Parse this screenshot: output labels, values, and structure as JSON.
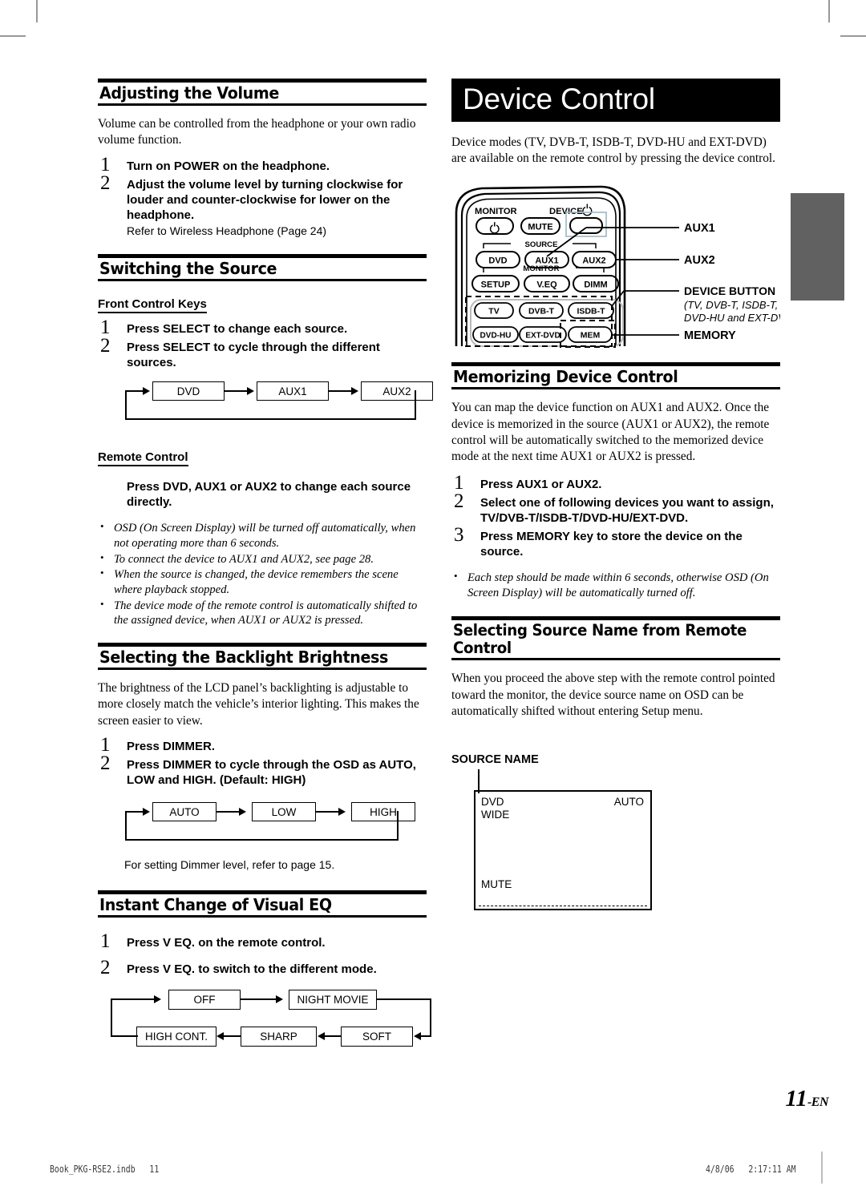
{
  "page": {
    "number": "11",
    "lang_suffix": "-EN",
    "footer_left": "Book_PKG-RSE2.indb   11",
    "footer_right": "4/8/06   2:17:11 AM"
  },
  "left_column": {
    "volume": {
      "heading": "Adjusting the Volume",
      "intro": "Volume can be controlled from the headphone or your own radio volume function.",
      "steps": [
        {
          "num": "1",
          "pre": "Turn on ",
          "kbd": "POWER",
          "post": " on the headphone.",
          "sub": ""
        },
        {
          "num": "2",
          "pre": "Adjust the volume level by turning clockwise for louder and counter-clockwise for lower on the headphone.",
          "kbd": "",
          "post": "",
          "sub": "Refer to Wireless Headphone (Page 24)"
        }
      ]
    },
    "switching": {
      "heading": "Switching the Source",
      "subhead_front": "Front Control Keys",
      "steps": [
        {
          "num": "1",
          "pre": "Press ",
          "kbd": "SELECT",
          "post": " to change each source."
        },
        {
          "num": "2",
          "pre": "Press ",
          "kbd": "SELECT",
          "post": " to cycle through the different sources."
        }
      ],
      "source_flow": [
        "DVD",
        "AUX1",
        "AUX2"
      ],
      "subhead_remote": "Remote Control",
      "remote_instruction_pre": "Press ",
      "remote_instruction_kbd1": "DVD, AUX1",
      "remote_instruction_mid": " or ",
      "remote_instruction_kbd2": "AUX2",
      "remote_instruction_post": " to change each source directly.",
      "notes": [
        "OSD (On Screen Display) will be turned off automatically, when not operating more than 6 seconds.",
        "To connect the device to AUX1 and AUX2, see page 28.",
        "When the source is changed, the device remembers the scene where playback stopped.",
        "The device mode of the remote control is automatically shifted to the assigned device, when AUX1 or AUX2 is pressed."
      ]
    },
    "backlight": {
      "heading": "Selecting the Backlight Brightness",
      "intro": "The brightness of the LCD panel’s backlighting is adjustable to more closely match the vehicle’s interior lighting. This makes the screen easier to view.",
      "steps": [
        {
          "num": "1",
          "pre": "Press ",
          "kbd": "DIMMER",
          "post": "."
        },
        {
          "num": "2",
          "pre": "Press ",
          "kbd": "DIMMER",
          "post": " to cycle through the OSD as AUTO, LOW and HIGH. (Default: HIGH)"
        }
      ],
      "dimmer_flow": [
        "AUTO",
        "LOW",
        "HIGH"
      ],
      "footnote": "For setting Dimmer level, refer to page 15."
    },
    "visualeq": {
      "heading": "Instant Change of Visual EQ",
      "steps": [
        {
          "num": "1",
          "pre": "Press ",
          "kbd": "V EQ.",
          "post": " on the remote control."
        },
        {
          "num": "2",
          "pre": "Press ",
          "kbd": "V EQ.",
          "post": " to switch to the different mode."
        }
      ],
      "eq_flow_top": [
        "OFF",
        "NIGHT MOVIE"
      ],
      "eq_flow_bottom": [
        "HIGH CONT.",
        "SHARP",
        "SOFT"
      ]
    }
  },
  "right_column": {
    "title_bar": "Device Control",
    "intro": "Device modes (TV, DVB-T, ISDB-T, DVD-HU and EXT-DVD) are available on the remote control by pressing the device control.",
    "remote": {
      "label_monitor_power": "MONITOR",
      "label_device_power": "DEVICE",
      "buttons": {
        "mute": "MUTE",
        "dvd": "DVD",
        "aux1": "AUX1",
        "aux2": "AUX2",
        "setup": "SETUP",
        "veq": "V.EQ",
        "dimm": "DIMM",
        "tv": "TV",
        "dvbt": "DVB-T",
        "isdbt": "ISDB-T",
        "dvdhu": "DVD-HU",
        "extdvd": "EXT-DVD",
        "mem": "MEM"
      },
      "group_source": "SOURCE",
      "group_monitor": "MONITOR",
      "callouts": {
        "aux1": "AUX1",
        "aux2": "AUX2",
        "device_button": "DEVICE BUTTON",
        "device_button_sub": "(TV, DVB-T, ISDB-T, DVD-HU and EXT-DVD)",
        "memory": "MEMORY"
      }
    },
    "memorizing": {
      "heading": "Memorizing Device Control",
      "intro": "You can map the device function on AUX1 and AUX2. Once the device is memorized in the source (AUX1 or AUX2), the remote control will be automatically switched to the memorized device mode at the next time AUX1 or AUX2 is pressed.",
      "steps": [
        {
          "num": "1",
          "pre": "Press ",
          "kbd": "AUX1",
          "mid": " or ",
          "kbd2": "AUX2",
          "post": "."
        },
        {
          "num": "2",
          "pre": "Select one of following devices you want to assign, ",
          "kbd": "TV/DVB-T/ISDB-T/DVD-HU/EXT-DVD",
          "post": "."
        },
        {
          "num": "3",
          "pre": "Press  ",
          "kbd": "MEMORY",
          "post": " key to store the device on the source."
        }
      ],
      "notes": [
        "Each step should be made within 6 seconds, otherwise OSD (On Screen Display) will be automatically turned off."
      ]
    },
    "source_name": {
      "heading": "Selecting Source Name from Remote Control",
      "intro": "When you proceed the above step with the remote control pointed toward the monitor, the device source name on OSD can be automatically shifted without entering Setup menu.",
      "callout": "SOURCE NAME",
      "osd": {
        "source": "DVD",
        "aspect": "WIDE",
        "dimmer": "AUTO",
        "mute": "MUTE"
      }
    }
  }
}
